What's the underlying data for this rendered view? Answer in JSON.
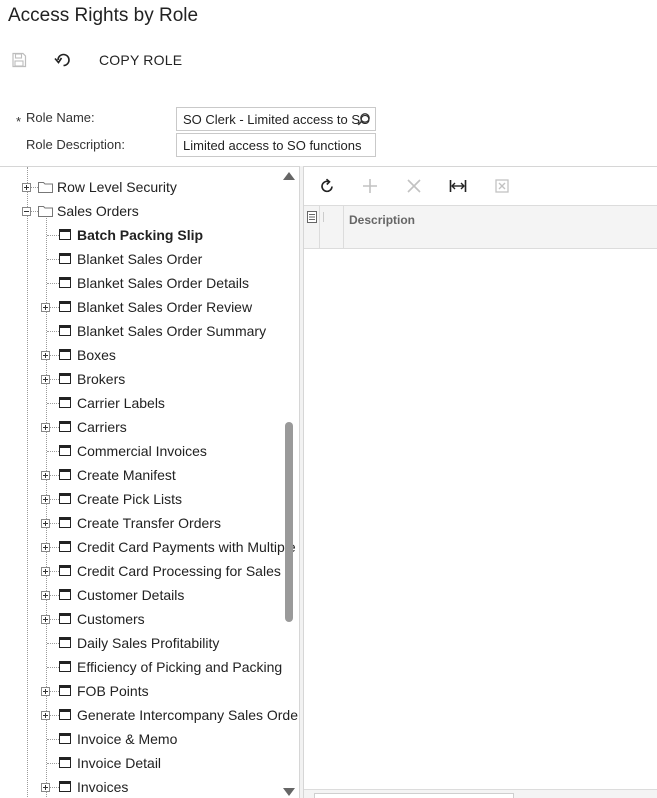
{
  "page": {
    "title": "Access Rights by Role"
  },
  "toolbar": {
    "save_icon": "save-icon",
    "undo_icon": "undo-icon",
    "copy_role_label": "COPY ROLE"
  },
  "form": {
    "required_marker": "*",
    "role_name_label": "Role Name:",
    "role_name_value": "SO Clerk - Limited access to SO",
    "role_name_lookup_icon": "search-icon",
    "role_description_label": "Role Description:",
    "role_description_value": "Limited access to SO functions"
  },
  "tree": {
    "nodes": [
      {
        "label": "Row Level Security",
        "kind": "folder",
        "expander": "plus",
        "bold": false
      },
      {
        "label": "Sales Orders",
        "kind": "folder",
        "expander": "minus",
        "bold": false
      },
      {
        "label": "Batch Packing Slip",
        "kind": "screen",
        "expander": "none",
        "bold": true
      },
      {
        "label": "Blanket Sales Order",
        "kind": "screen",
        "expander": "none",
        "bold": false
      },
      {
        "label": "Blanket Sales Order Details",
        "kind": "screen",
        "expander": "none",
        "bold": false
      },
      {
        "label": "Blanket Sales Order Review",
        "kind": "screen",
        "expander": "plus",
        "bold": false
      },
      {
        "label": "Blanket Sales Order Summary",
        "kind": "screen",
        "expander": "none",
        "bold": false
      },
      {
        "label": "Boxes",
        "kind": "screen",
        "expander": "plus",
        "bold": false
      },
      {
        "label": "Brokers",
        "kind": "screen",
        "expander": "plus",
        "bold": false
      },
      {
        "label": "Carrier Labels",
        "kind": "screen",
        "expander": "none",
        "bold": false
      },
      {
        "label": "Carriers",
        "kind": "screen",
        "expander": "plus",
        "bold": false
      },
      {
        "label": "Commercial Invoices",
        "kind": "screen",
        "expander": "none",
        "bold": false
      },
      {
        "label": "Create Manifest",
        "kind": "screen",
        "expander": "plus",
        "bold": false
      },
      {
        "label": "Create Pick Lists",
        "kind": "screen",
        "expander": "plus",
        "bold": false
      },
      {
        "label": "Create Transfer Orders",
        "kind": "screen",
        "expander": "plus",
        "bold": false
      },
      {
        "label": "Credit Card Payments with Multiple",
        "kind": "screen",
        "expander": "plus",
        "bold": false
      },
      {
        "label": "Credit Card Processing for Sales",
        "kind": "screen",
        "expander": "plus",
        "bold": false
      },
      {
        "label": "Customer Details",
        "kind": "screen",
        "expander": "plus",
        "bold": false
      },
      {
        "label": "Customers",
        "kind": "screen",
        "expander": "plus",
        "bold": false
      },
      {
        "label": "Daily Sales Profitability",
        "kind": "screen",
        "expander": "none",
        "bold": false
      },
      {
        "label": "Efficiency of Picking and Packing",
        "kind": "screen",
        "expander": "none",
        "bold": false
      },
      {
        "label": "FOB Points",
        "kind": "screen",
        "expander": "plus",
        "bold": false
      },
      {
        "label": "Generate Intercompany Sales Orde",
        "kind": "screen",
        "expander": "plus",
        "bold": false
      },
      {
        "label": "Invoice & Memo",
        "kind": "screen",
        "expander": "none",
        "bold": false
      },
      {
        "label": "Invoice Detail",
        "kind": "screen",
        "expander": "none",
        "bold": false
      },
      {
        "label": "Invoices",
        "kind": "screen",
        "expander": "plus",
        "bold": false
      }
    ]
  },
  "grid": {
    "toolbar_icons": [
      "refresh-icon",
      "add-icon",
      "delete-icon",
      "fit-columns-icon",
      "export-excel-icon"
    ],
    "columns": {
      "description": "Description"
    },
    "rows": []
  }
}
